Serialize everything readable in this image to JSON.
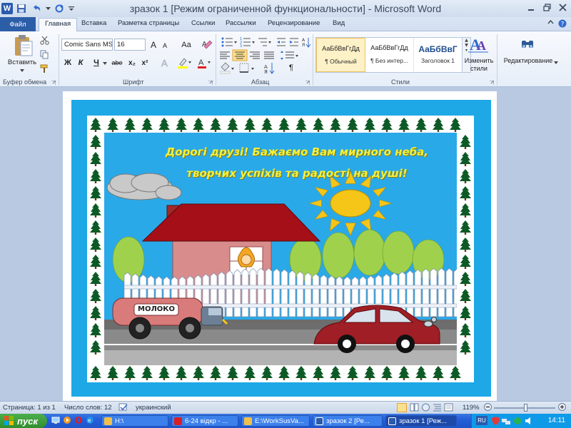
{
  "window": {
    "title": "зразок 1 [Режим ограниченной функциональности]  -  Microsoft Word",
    "app_logo": "W"
  },
  "tabs": [
    "Файл",
    "Главная",
    "Вставка",
    "Разметка страницы",
    "Ссылки",
    "Рассылки",
    "Рецензирование",
    "Вид"
  ],
  "ribbon": {
    "clipboard": {
      "paste_label": "Вставить",
      "group_label": "Буфер обмена"
    },
    "font": {
      "font_name": "Comic Sans MS",
      "font_size": "16",
      "grow_label": "A",
      "shrink_label": "A",
      "case_label": "Aa",
      "bold": "Ж",
      "italic": "К",
      "underline": "Ч",
      "strike": "abe",
      "subscript": "x₂",
      "superscript": "x²",
      "group_label": "Шрифт"
    },
    "paragraph": {
      "group_label": "Абзац",
      "pilcrow": "¶"
    },
    "styles": {
      "items": [
        {
          "sample": "АаБбВвГгДд",
          "name": "¶ Обычный"
        },
        {
          "sample": "АаБбВвГгДд",
          "name": "¶ Без интер..."
        },
        {
          "sample": "АаБбВвГ",
          "name": "Заголовок 1"
        }
      ],
      "change_label_1": "Изменить",
      "change_label_2": "стили",
      "group_label": "Стили"
    },
    "editing": {
      "label": "Редактирование"
    }
  },
  "document": {
    "greeting_line1": "Дорогі друзі! Бажаємо Вам мирного неба,",
    "greeting_line2": "творчих успіхів та радості на душі!",
    "truck_label": "МОЛОКО",
    "colors": {
      "border_blue": "#1ea8e6",
      "sky": "#2aa9e8",
      "roof": "#a50f17",
      "wall": "#d88c8c",
      "sun": "#f5c518",
      "road": "#8a8a8a",
      "tree": "#0d5a26",
      "bush": "#9fd14d",
      "fence": "#ffffff"
    }
  },
  "statusbar": {
    "page": "Страница: 1 из 1",
    "words": "Число слов: 12",
    "language": "украинский",
    "zoom": "119%"
  },
  "taskbar": {
    "start": "пуск",
    "buttons": [
      {
        "label": "H:\\"
      },
      {
        "label": "6-24 відкр - ..."
      },
      {
        "label": "E:\\WorkSusVa..."
      },
      {
        "label": "зразок 2 [Ре..."
      },
      {
        "label": "зразок 1 [Реж..."
      }
    ],
    "tray_lang": "RU",
    "clock": "14:11"
  }
}
